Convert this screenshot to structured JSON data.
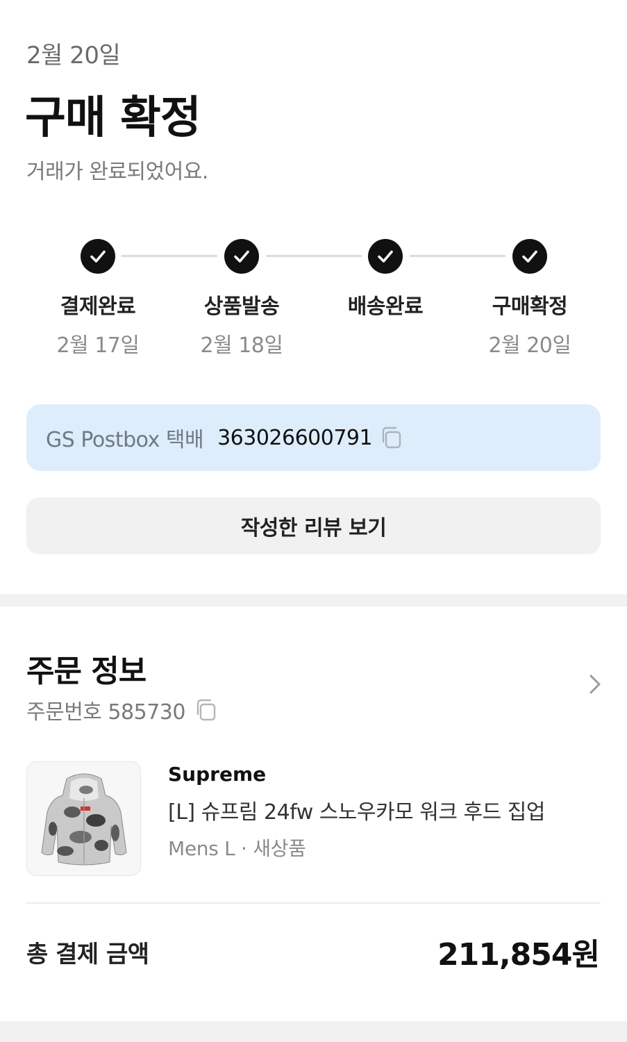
{
  "header": {
    "date": "2월 20일",
    "title": "구매 확정",
    "subtitle": "거래가 완료되었어요."
  },
  "steps": [
    {
      "label": "결제완료",
      "date": "2월 17일"
    },
    {
      "label": "상품발송",
      "date": "2월 18일"
    },
    {
      "label": "배송완료",
      "date": ""
    },
    {
      "label": "구매확정",
      "date": "2월 20일"
    }
  ],
  "tracking": {
    "carrier": "GS Postbox 택배",
    "number": "363026600791"
  },
  "review_button": {
    "label": "작성한 리뷰 보기"
  },
  "order": {
    "title": "주문 정보",
    "order_number": "주문번호 585730"
  },
  "product": {
    "brand": "Supreme",
    "name": "[L] 슈프림 24fw 스노우카모 워크 후드 집업",
    "options": "Mens L · 새상품"
  },
  "total": {
    "label": "총 결제 금액",
    "value": "211,854원"
  },
  "colors": {
    "tracking_bg": "#deedfb",
    "accent_dark": "#111111",
    "muted": "#8a8a8a"
  },
  "icons": [
    "check-icon",
    "copy-icon",
    "chevron-right-icon"
  ]
}
